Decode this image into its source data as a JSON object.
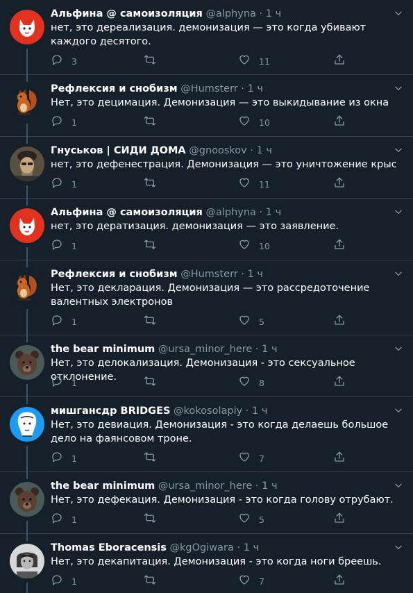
{
  "tweets": [
    {
      "name": "Альфина @ самоизоляция",
      "handle": "@alphyna",
      "dot": "·",
      "time": "1 ч",
      "text": "нет, это дереализация. демонизация — это когда убивают каждого десятого.",
      "replies": "3",
      "likes": "11",
      "avatar": "fox-avatar"
    },
    {
      "name": "Рефлексия и снобизм",
      "handle": "@Humsterr",
      "dot": "·",
      "time": "1 ч",
      "text": "Нет, это децимация. Демонизация — это выкидывание из окна",
      "replies": "1",
      "likes": "10",
      "avatar": "squirrel-avatar"
    },
    {
      "name": "Гнуськов | СИДИ ДОМА",
      "handle": "@gnooskov",
      "dot": "·",
      "time": "1 ч",
      "text": "нет, это дефенестрация. Демонизация — это уничтожение крыс",
      "replies": "1",
      "likes": "11",
      "avatar": "man-avatar"
    },
    {
      "name": "Альфина @ самоизоляция",
      "handle": "@alphyna",
      "dot": "·",
      "time": "1 ч",
      "text": "нет, это дератизация. демонизация — это заявление.",
      "replies": "1",
      "likes": "10",
      "avatar": "fox-avatar"
    },
    {
      "name": "Рефлексия и снобизм",
      "handle": "@Humsterr",
      "dot": "·",
      "time": "1 ч",
      "text": "Нет, это декларация. Демонизация — это рассредоточение валентных электронов",
      "replies": "1",
      "likes": "5",
      "avatar": "squirrel-avatar"
    },
    {
      "name": "the bear minimum",
      "handle": "@ursa_minor_here",
      "dot": "·",
      "time": "1 ч",
      "text": "Нет, это делокализация. Демонизация - это сексуальное отклонение.",
      "replies": "1",
      "likes": "8",
      "avatar": "bear-avatar"
    },
    {
      "name": "мишгансдр BRIDGES",
      "handle": "@kokosolapiy",
      "dot": "·",
      "time": "1 ч",
      "text": "Нет, это девиация. Демонизация - это когда делаешь большое дело на фаянсовом троне.",
      "replies": "1",
      "likes": "7",
      "avatar": "cartoon-avatar"
    },
    {
      "name": "the bear minimum",
      "handle": "@ursa_minor_here",
      "dot": "·",
      "time": "1 ч",
      "text": "Нет, это дефекация. Демонизация - это когда голову отрубают.",
      "replies": "1",
      "likes": "5",
      "avatar": "bear-avatar"
    },
    {
      "name": "Thomas Eboracensis",
      "handle": "@kgOgiwara",
      "dot": "·",
      "time": "1 ч",
      "text": "Нет, это декапитация. Демонизация - это когда ноги бреешь.",
      "replies": "1",
      "likes": "7",
      "avatar": "portrait-avatar"
    }
  ],
  "colors": {
    "background": "#15202b",
    "muted": "#8899a6",
    "border": "#38444d",
    "thread": "#3d5466"
  }
}
